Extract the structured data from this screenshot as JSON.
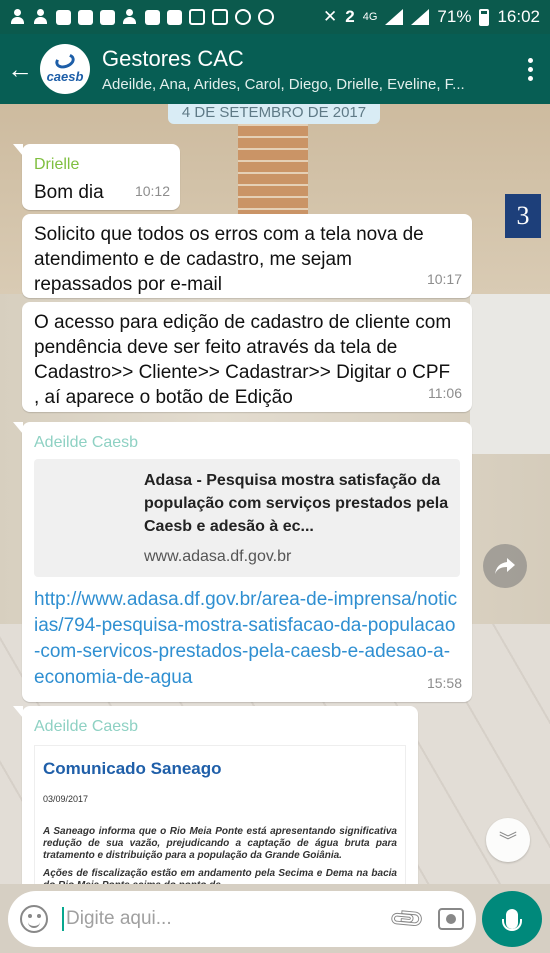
{
  "status_bar": {
    "network": "4G",
    "battery": "71%",
    "time": "16:02"
  },
  "header": {
    "group_name": "Gestores CAC",
    "participants": "Adeilde, Ana, Arides, Carol, Diego, Drielle, Eveline, F...",
    "avatar_text": "caesb",
    "colors": {
      "header": "#075e54",
      "status": "#0b5a4d"
    }
  },
  "chat": {
    "date_chip": "4 DE SETEMBRO DE 2017",
    "wall_sign": "3",
    "messages": [
      {
        "sender": "Drielle",
        "sender_color": "#7fbf3f",
        "text": "Bom dia",
        "time": "10:12"
      },
      {
        "text": "Solicito que todos os erros com a tela nova de atendimento e de cadastro, me sejam repassados por e-mail",
        "time": "10:17"
      },
      {
        "text": "O acesso para edição de cadastro de cliente com pendência deve ser feito através da tela de Cadastro>> Cliente>> Cadastrar>> Digitar o CPF , aí aparece o botão de Edição",
        "time": "11:06"
      },
      {
        "sender": "Adeilde Caesb",
        "sender_color": "#8ed1c3",
        "link_preview": {
          "title": "Adasa - Pesquisa mostra satisfação da população com serviços prestados pela Caesb e adesão à ec...",
          "domain": "www.adasa.df.gov.br"
        },
        "url": "http://www.adasa.df.gov.br/area-de-imprensa/noticias/794-pesquisa-mostra-satisfacao-da-populacao-com-servicos-prestados-pela-caesb-e-adesao-a-economia-de-agua",
        "time": "15:58"
      },
      {
        "sender": "Adeilde Caesb",
        "sender_color": "#8ed1c3",
        "document": {
          "heading": "Comunicado Saneago",
          "date": "03/09/2017",
          "para1": "A Saneago informa que o Rio Meia Ponte está apresentando significativa redução de sua vazão, prejudicando a captação de água bruta para tratamento e distribuição para a população da Grande Goiânia.",
          "para2": "Ações de fiscalização estão em andamento pela Secima e Dema na bacia do Rio Meia Ponte acima do ponto de"
        }
      }
    ]
  },
  "input_bar": {
    "placeholder": "Digite aqui..."
  }
}
